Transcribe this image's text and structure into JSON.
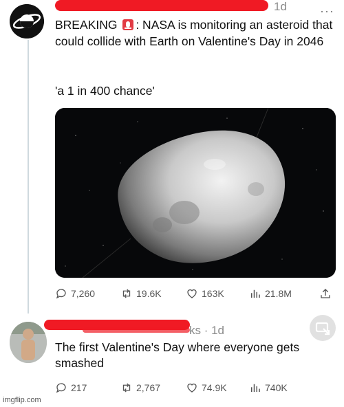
{
  "tweet1": {
    "time": "1d",
    "text_breaking": "BREAKING",
    "text_body": ": NASA is monitoring an asteroid that could collide with Earth on Valentine's Day in 2046",
    "quote": "'a 1 in 400 chance'",
    "replies": "7,260",
    "retweets": "19.6K",
    "likes": "163K",
    "views": "21.8M"
  },
  "tweet2": {
    "time_suffix": "ks · 1d",
    "text": "The first Valentine's Day where everyone gets smashed",
    "replies": "217",
    "retweets": "2,767",
    "likes": "74.9K",
    "views": "740K"
  },
  "watermark": "imgflip.com",
  "colors": {
    "redaction": "#f01a24",
    "icon_gray": "#555555",
    "thread_line": "#cfd9de"
  }
}
